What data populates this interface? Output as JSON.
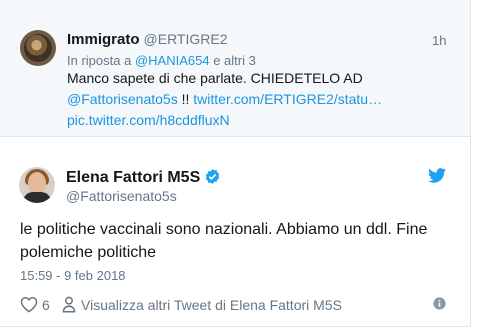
{
  "reply_tweet": {
    "name": "Immigrato",
    "handle": "@ERTIGRE2",
    "time": "1h",
    "replying_prefix": "In riposta a",
    "replying_mention": "@HANIA654",
    "replying_suffix": "e altri 3",
    "line1": "Manco sapete di che parlate. CHIEDETELO AD",
    "line2_mention": "@Fattorisenato5s",
    "line2_bang": "!!",
    "line2_link": "twitter.com/ERTIGRE2/statu…",
    "line3_link": "pic.twitter.com/h8cddfluxN"
  },
  "main_tweet": {
    "name": "Elena Fattori M5S",
    "handle": "@Fattorisenato5s",
    "text_line1": "le politiche vaccinali sono nazionali. Abbiamo un ddl. Fine",
    "text_line2": "polemiche politiche",
    "timestamp": "15:59 - 9 feb 2018",
    "likes": "6",
    "more_tweets": "Visualizza altri Tweet di Elena Fattori M5S"
  },
  "colors": {
    "link": "#1b95e0",
    "muted": "#657786",
    "verified": "#1da1f2"
  },
  "icons": [
    "heart-icon",
    "person-icon",
    "info-icon",
    "twitter-bird-icon",
    "verified-badge-icon"
  ]
}
